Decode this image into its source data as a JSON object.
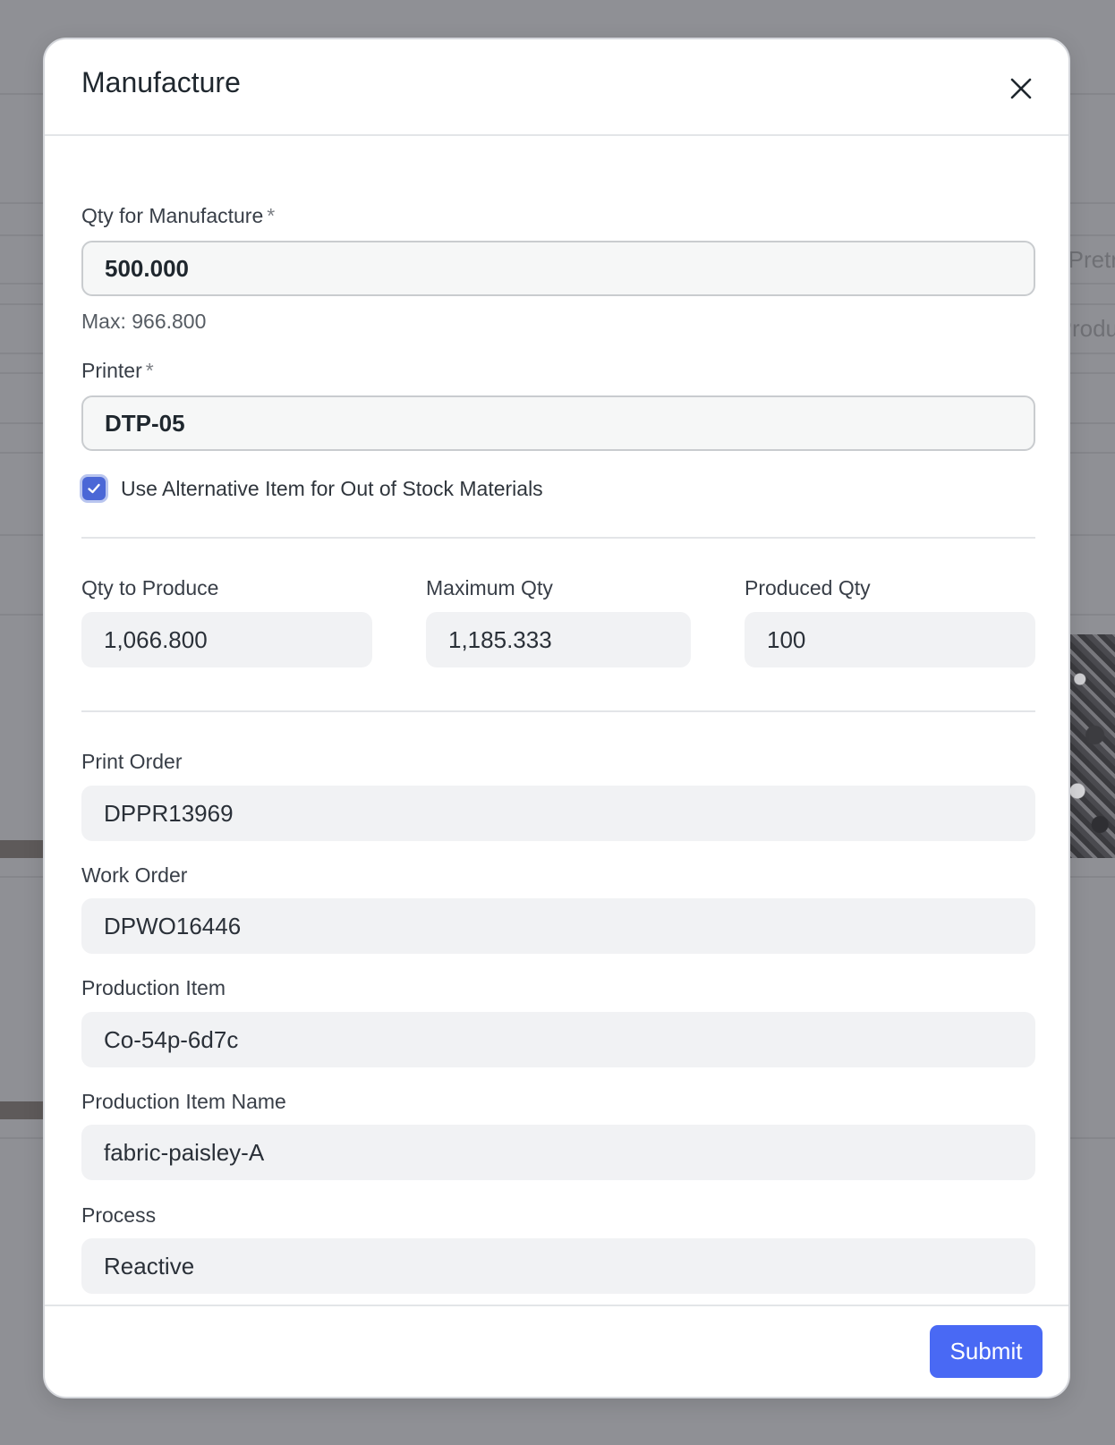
{
  "background": {
    "right_text_1": "Pretr",
    "right_text_2": "Produ"
  },
  "modal": {
    "title": "Manufacture",
    "close_icon": "close-icon",
    "qty_for_manufacture": {
      "label": "Qty for Manufacture",
      "required_mark": "*",
      "value": "500.000",
      "help": "Max: 966.800"
    },
    "printer": {
      "label": "Printer",
      "required_mark": "*",
      "value": "DTP-05"
    },
    "use_alternative": {
      "label": "Use Alternative Item for Out of Stock Materials",
      "checked": true
    },
    "qty_to_produce": {
      "label": "Qty to Produce",
      "value": "1,066.800"
    },
    "maximum_qty": {
      "label": "Maximum Qty",
      "value": "1,185.333"
    },
    "produced_qty": {
      "label": "Produced Qty",
      "value": "100"
    },
    "print_order": {
      "label": "Print Order",
      "value": "DPPR13969"
    },
    "work_order": {
      "label": "Work Order",
      "value": "DPWO16446"
    },
    "production_item": {
      "label": "Production Item",
      "value": "Co-54p-6d7c"
    },
    "production_item_name": {
      "label": "Production Item Name",
      "value": "fabric-paisley-A"
    },
    "process": {
      "label": "Process",
      "value": "Reactive"
    },
    "submit_label": "Submit"
  },
  "colors": {
    "primary": "#4969f4",
    "checkbox": "#4b67d6",
    "overlay": "#8f9095"
  }
}
